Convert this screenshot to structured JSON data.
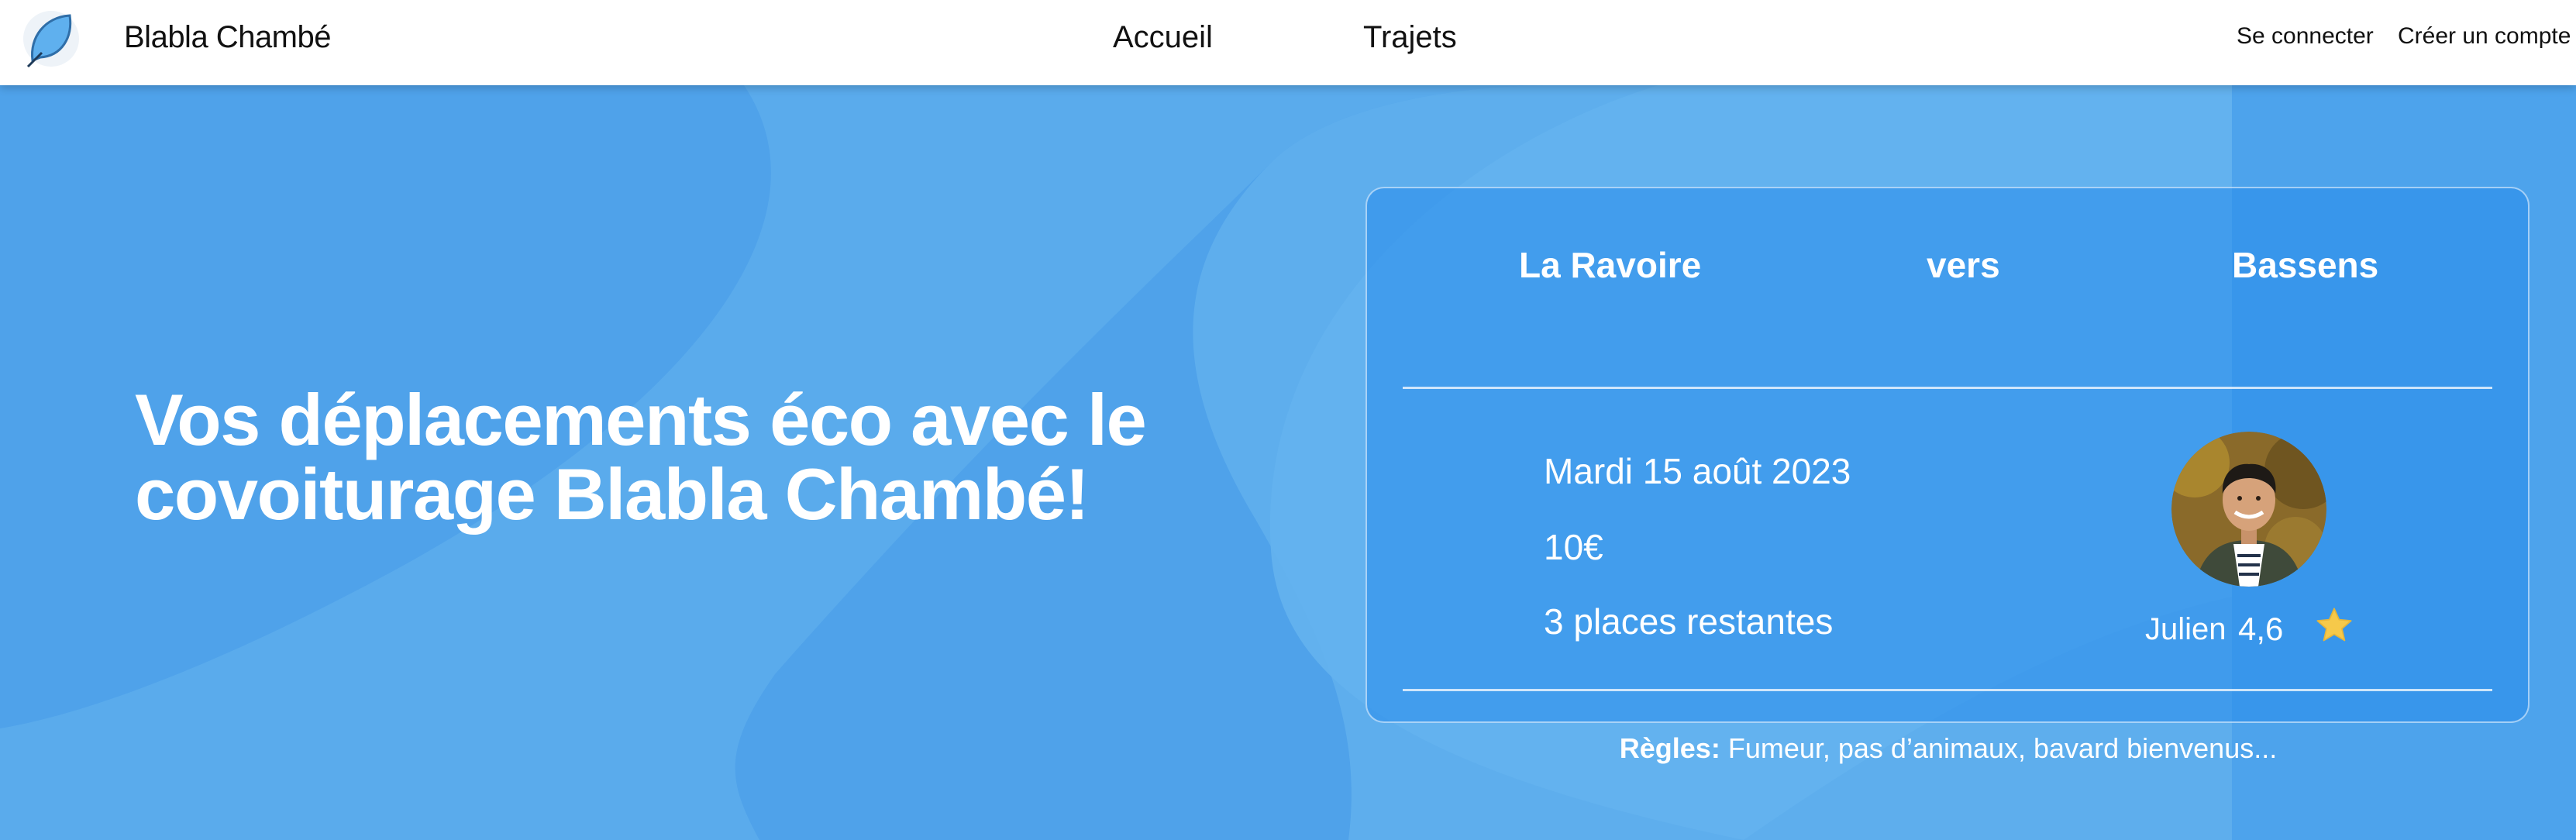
{
  "navbar": {
    "brand": "Blabla Chambé",
    "links": [
      {
        "label": "Accueil"
      },
      {
        "label": "Trajets"
      }
    ],
    "auth": {
      "login": "Se connecter",
      "signup": "Créer un compte"
    },
    "logo_icon": "leaf-icon"
  },
  "hero": {
    "headline_line1": "Vos déplacements éco avec le",
    "headline_line2": "covoiturage Blabla Chambé!",
    "background_color": "#4fa2ea"
  },
  "trip": {
    "from": "La Ravoire",
    "connector": "vers",
    "to": "Bassens",
    "date": "Mardi 15 août 2023",
    "price": "10€",
    "seats": "3 places restantes",
    "driver": {
      "name": "Julien",
      "rating": "4,6",
      "rating_icon": "star-icon"
    },
    "rules_label": "Règles:",
    "rules_text": "Fumeur, pas d’animaux, bavard bienvenus..."
  },
  "colors": {
    "accent": "#4fa2ea",
    "star": "#f6c94a",
    "text_on_blue": "#ffffff"
  }
}
